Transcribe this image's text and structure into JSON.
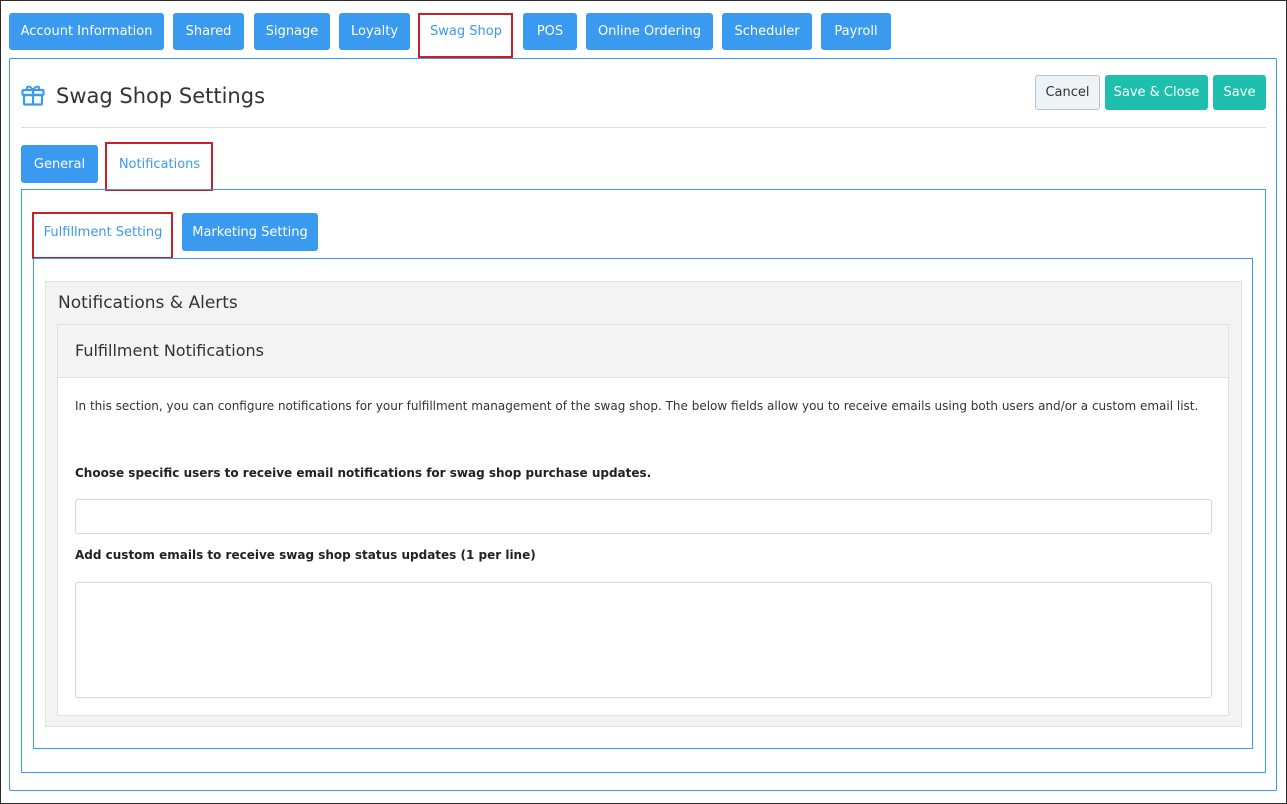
{
  "top_tabs": [
    {
      "label": "Account Information",
      "active": false
    },
    {
      "label": "Shared",
      "active": false
    },
    {
      "label": "Signage",
      "active": false
    },
    {
      "label": "Loyalty",
      "active": false
    },
    {
      "label": "Swag Shop",
      "active": true
    },
    {
      "label": "POS",
      "active": false
    },
    {
      "label": "Online Ordering",
      "active": false
    },
    {
      "label": "Scheduler",
      "active": false
    },
    {
      "label": "Payroll",
      "active": false
    }
  ],
  "header": {
    "icon": "gift-icon",
    "title": "Swag Shop Settings",
    "buttons": {
      "cancel": "Cancel",
      "save_close": "Save & Close",
      "save": "Save"
    }
  },
  "settings_tabs": [
    {
      "label": "General",
      "active": false
    },
    {
      "label": "Notifications",
      "active": true
    }
  ],
  "notification_tabs": [
    {
      "label": "Fulfillment Setting",
      "active": true
    },
    {
      "label": "Marketing Setting",
      "active": false
    }
  ],
  "section": {
    "title": "Notifications & Alerts",
    "card": {
      "title": "Fulfillment Notifications",
      "description": "In this section, you can configure notifications for your fulfillment management of the swag shop. The below fields allow you to receive emails using both users and/or a custom email list.",
      "users_label": "Choose specific users to receive email notifications for swag shop purchase updates.",
      "users_value": "",
      "emails_label": "Add custom emails to receive swag shop status updates (1 per line)",
      "emails_value": ""
    }
  },
  "colors": {
    "primary": "#3a9af0",
    "success": "#1fbfae",
    "highlight_outline": "#c8202a"
  }
}
